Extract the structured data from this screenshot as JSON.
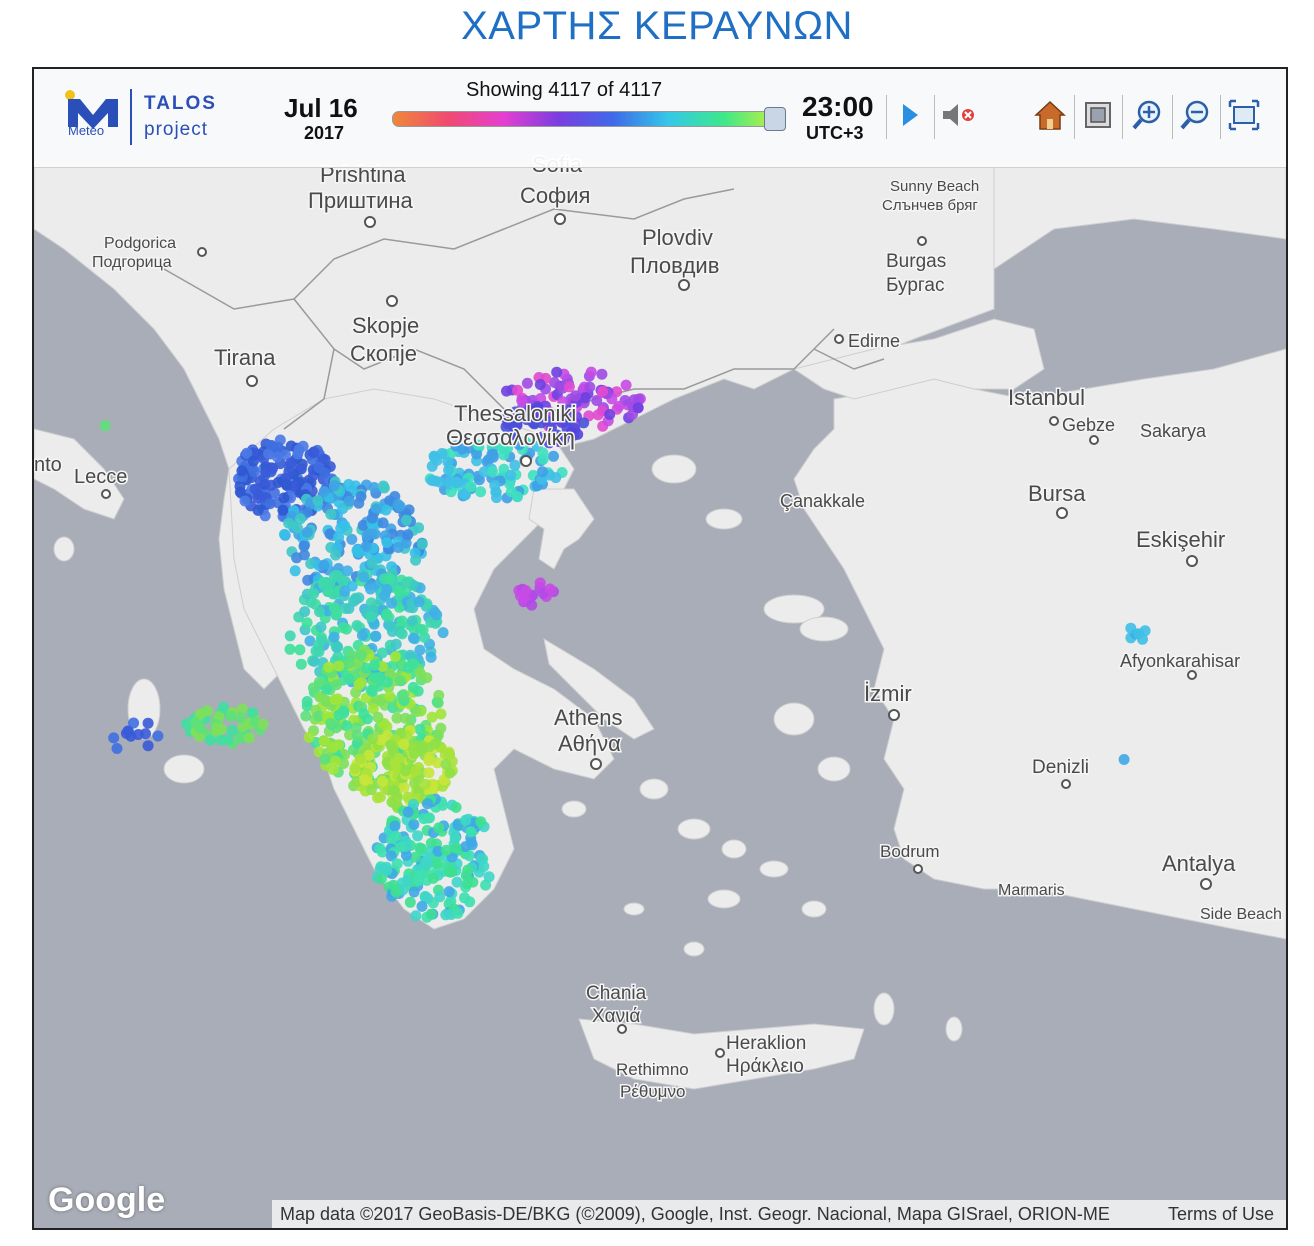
{
  "page_title": "ΧΑΡΤΗΣ ΚΕΡΑΥΝΩΝ",
  "logo": {
    "meteo": "Meteo",
    "talos": "TALOS",
    "project": "project"
  },
  "date": {
    "day": "Jul 16",
    "year": "2017"
  },
  "showing": "Showing 4117 of 4117",
  "time": {
    "clock": "23:00",
    "zone": "UTC+3"
  },
  "slider_position": 1.0,
  "toolbar_icons": [
    "play-icon",
    "mute-icon",
    "home-icon",
    "layers-icon",
    "zoom-in-icon",
    "zoom-out-icon",
    "fullscreen-icon"
  ],
  "attribution": {
    "map_data": "Map data ©2017 GeoBasis-DE/BKG (©2009), Google, Inst. Geogr. Nacional, Mapa GISrael, ORION-ME",
    "terms": "Terms of Use",
    "google": "Google"
  },
  "colors": {
    "title": "#1f6fc4",
    "sea": "#a8adb8",
    "land": "#ececec",
    "brand": "#2b4fb8"
  },
  "cities": [
    "Prishtina",
    "Приштина",
    "Sofia",
    "София",
    "Podgorica",
    "Подгорица",
    "Plovdiv",
    "Пловдив",
    "Sunny Beach",
    "Слънчев бряг",
    "Burgas",
    "Бургас",
    "Skopje",
    "Скопје",
    "Tirana",
    "Edirne",
    "Thessaloniki",
    "Θεσσαλονίκη",
    "Istanbul",
    "Gebze",
    "Sakarya",
    "Lecce",
    "nto",
    "Çanakkale",
    "Bursa",
    "Eskişehir",
    "Afyonkarahisar",
    "İzmir",
    "Athens",
    "Αθήνα",
    "Denizli",
    "Bodrum",
    "Antalya",
    "Marmaris",
    "Side Beach",
    "Chania",
    "Χανιά",
    "Heraklion",
    "Ηράκλειο",
    "Rethimno",
    "Ρέθυμνο"
  ]
}
